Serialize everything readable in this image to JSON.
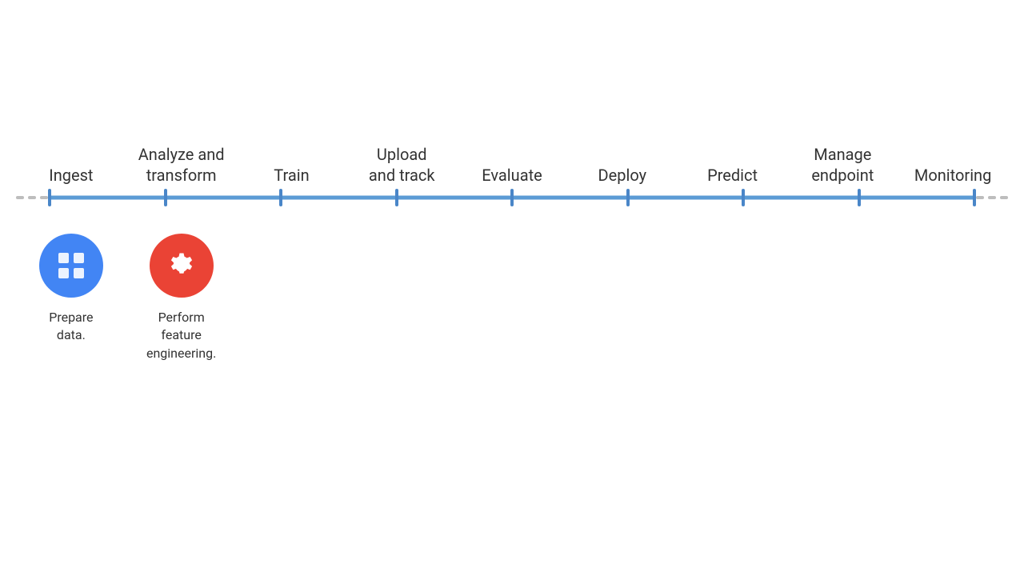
{
  "pipeline": {
    "steps": [
      {
        "id": "ingest",
        "label": "Ingest"
      },
      {
        "id": "analyze-transform",
        "label": "Analyze and\ntransform"
      },
      {
        "id": "train",
        "label": "Train"
      },
      {
        "id": "upload-track",
        "label": "Upload\nand track"
      },
      {
        "id": "evaluate",
        "label": "Evaluate"
      },
      {
        "id": "deploy",
        "label": "Deploy"
      },
      {
        "id": "predict",
        "label": "Predict"
      },
      {
        "id": "manage-endpoint",
        "label": "Manage\nendpoint"
      },
      {
        "id": "monitoring",
        "label": "Monitoring"
      }
    ],
    "icons": [
      {
        "id": "ingest-icon",
        "type": "blue",
        "label": "Prepare\ndata.",
        "icon": "grid"
      },
      {
        "id": "analyze-icon",
        "type": "red",
        "label": "Perform\nfeature\nengineering.",
        "icon": "gear"
      }
    ]
  }
}
